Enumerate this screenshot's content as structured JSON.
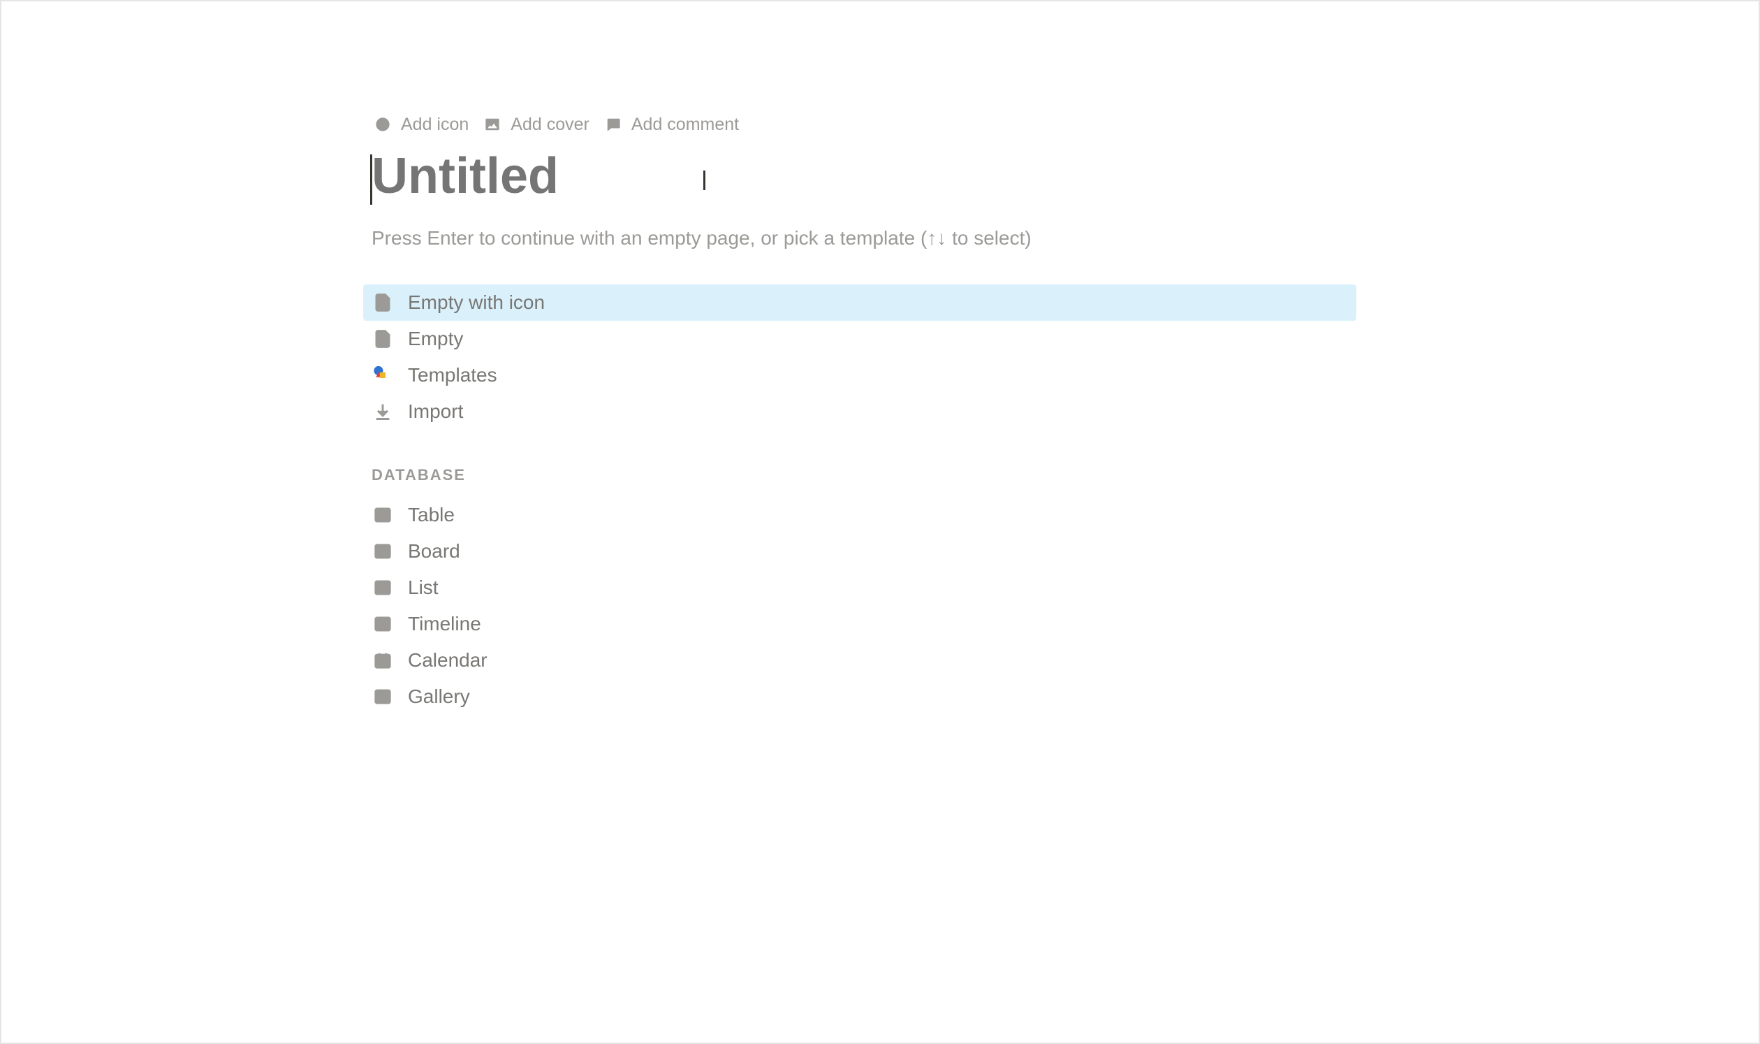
{
  "toolbar": {
    "add_icon_label": "Add icon",
    "add_cover_label": "Add cover",
    "add_comment_label": "Add comment"
  },
  "title": {
    "placeholder": "Untitled",
    "value": ""
  },
  "hint": "Press Enter to continue with an empty page, or pick a template (↑↓ to select)",
  "templates": [
    {
      "label": "Empty with icon",
      "highlighted": true,
      "icon": "page-with-lines"
    },
    {
      "label": "Empty",
      "highlighted": false,
      "icon": "page"
    },
    {
      "label": "Templates",
      "highlighted": false,
      "icon": "shapes"
    },
    {
      "label": "Import",
      "highlighted": false,
      "icon": "download"
    }
  ],
  "database_section_label": "DATABASE",
  "database_templates": [
    {
      "label": "Table",
      "icon": "table"
    },
    {
      "label": "Board",
      "icon": "board"
    },
    {
      "label": "List",
      "icon": "list"
    },
    {
      "label": "Timeline",
      "icon": "timeline"
    },
    {
      "label": "Calendar",
      "icon": "calendar"
    },
    {
      "label": "Gallery",
      "icon": "gallery"
    }
  ]
}
